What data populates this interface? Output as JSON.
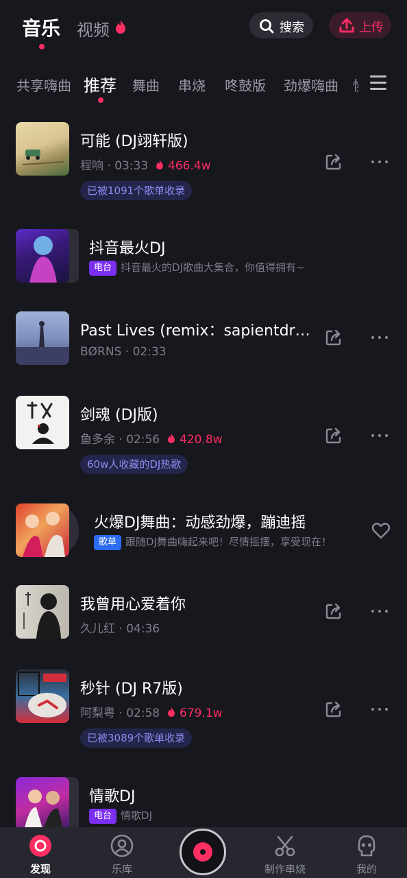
{
  "header": {
    "tab_music": "音乐",
    "tab_video": "视频",
    "search_label": "搜索",
    "upload_label": "上传"
  },
  "categories": [
    "共享嗨曲",
    "推荐",
    "舞曲",
    "串烧",
    "咚鼓版",
    "劲爆嗨曲",
    "慢"
  ],
  "songs": [
    {
      "title": "可能 (DJ翊轩版)",
      "artist": "程响",
      "duration": "03:33",
      "plays": "466.4w",
      "tag": "已被1091个歌单收录"
    },
    {
      "title": "Past Lives (remix：sapientdr…",
      "artist": "BØRNS",
      "duration": "02:33"
    },
    {
      "title": "剑魂 (DJ版)",
      "artist": "鱼多余",
      "duration": "02:56",
      "plays": "420.8w",
      "tag": "60w人收藏的DJ热歌"
    },
    {
      "title": "我曾用心爱着你",
      "artist": "久儿红",
      "duration": "04:36"
    },
    {
      "title": "秒针 (DJ R7版)",
      "artist": "阿梨粤",
      "duration": "02:58",
      "plays": "679.1w",
      "tag": "已被3089个歌单收录"
    }
  ],
  "collections": [
    {
      "title": "抖音最火DJ",
      "badge": "电台",
      "desc": "抖音最火的DJ歌曲大集合，你值得拥有~"
    },
    {
      "title": "火爆DJ舞曲：动感劲爆，蹦迪摇",
      "badge": "歌单",
      "desc": "跟随DJ舞曲嗨起来吧！尽情摇摆，享受现在！"
    },
    {
      "title": "情歌DJ",
      "badge": "电台",
      "desc": "情歌DJ"
    }
  ],
  "bottom_nav": [
    "发现",
    "乐库",
    "制作串烧",
    "我的"
  ],
  "sep": "·",
  "colors": {
    "accent": "#ff2e63",
    "background": "#17171e",
    "radio_badge": "#7b2ff0",
    "playlist_badge": "#2b6cf0"
  }
}
